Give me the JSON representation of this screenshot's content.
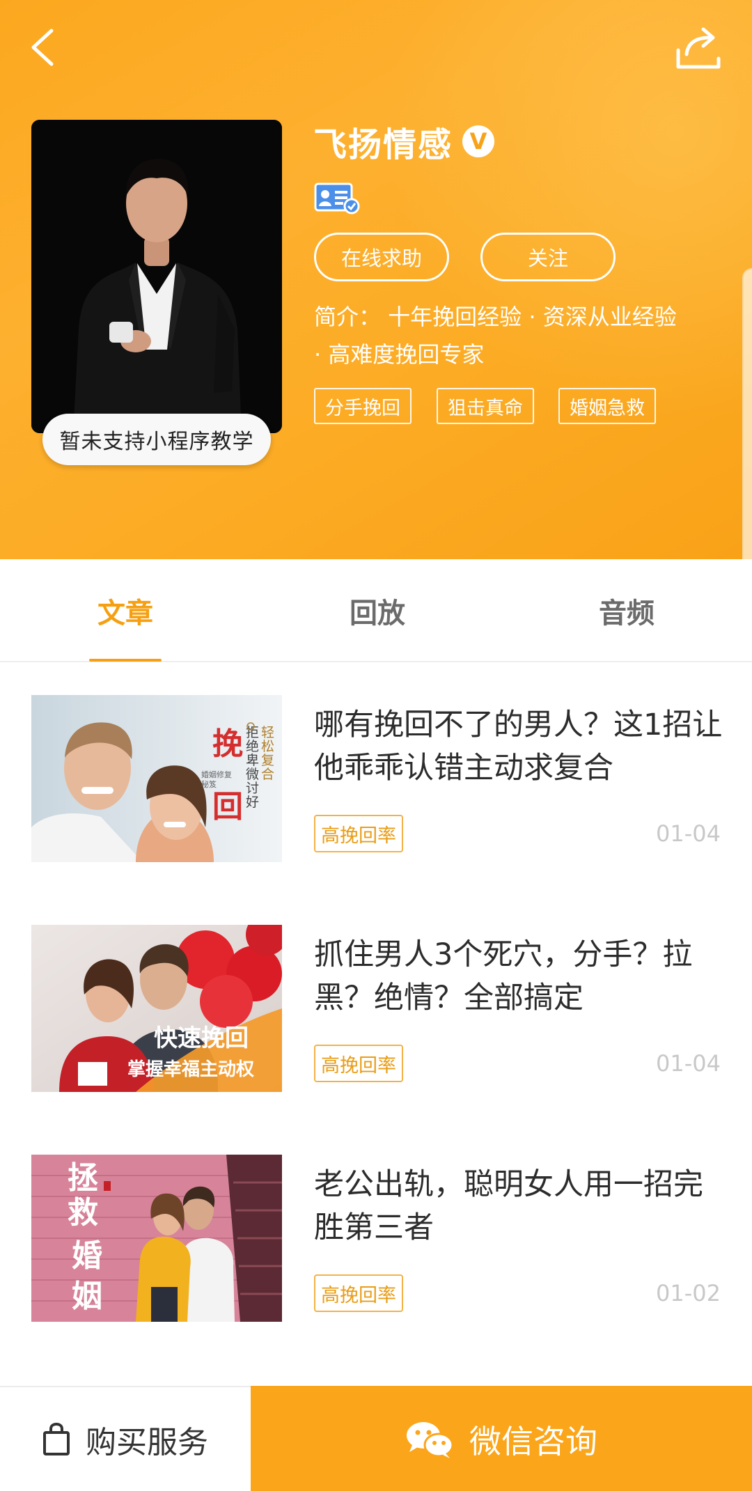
{
  "profile": {
    "name": "飞扬情感",
    "verified_mark": "V",
    "photo_badge": "暂未支持小程序教学",
    "help_button": "在线求助",
    "follow_button": "关注",
    "intro_line1": "简介：  十年挽回经验 · 资深从业经验",
    "intro_line2": "· 高难度挽回专家",
    "tags": [
      "分手挽回",
      "狙击真命",
      "婚姻急救"
    ],
    "accent_color": "#fca81f"
  },
  "tabs": [
    "文章",
    "回放",
    "音频"
  ],
  "articles": [
    {
      "title": "哪有挽回不了的男人？这1招让他乖乖认错主动求复合",
      "tag": "高挽回率",
      "date": "01-04",
      "thumb_text_big": "挽回",
      "thumb_text_side": "轻松复合",
      "thumb_text_side2": "拒绝卑微讨好",
      "thumb_text_small": "婚姻修复秘笈"
    },
    {
      "title": "抓住男人3个死穴，分手？拉黑？绝情？全部搞定",
      "tag": "高挽回率",
      "date": "01-04",
      "thumb_text_big": "快速挽回",
      "thumb_text_sub": "掌握幸福主动权"
    },
    {
      "title": "老公出轨，聪明女人用一招完胜第三者",
      "tag": "高挽回率",
      "date": "01-02",
      "thumb_text_big": "拯救婚姻"
    }
  ],
  "bottom": {
    "buy_label": "购买服务",
    "wechat_label": "微信咨询"
  }
}
